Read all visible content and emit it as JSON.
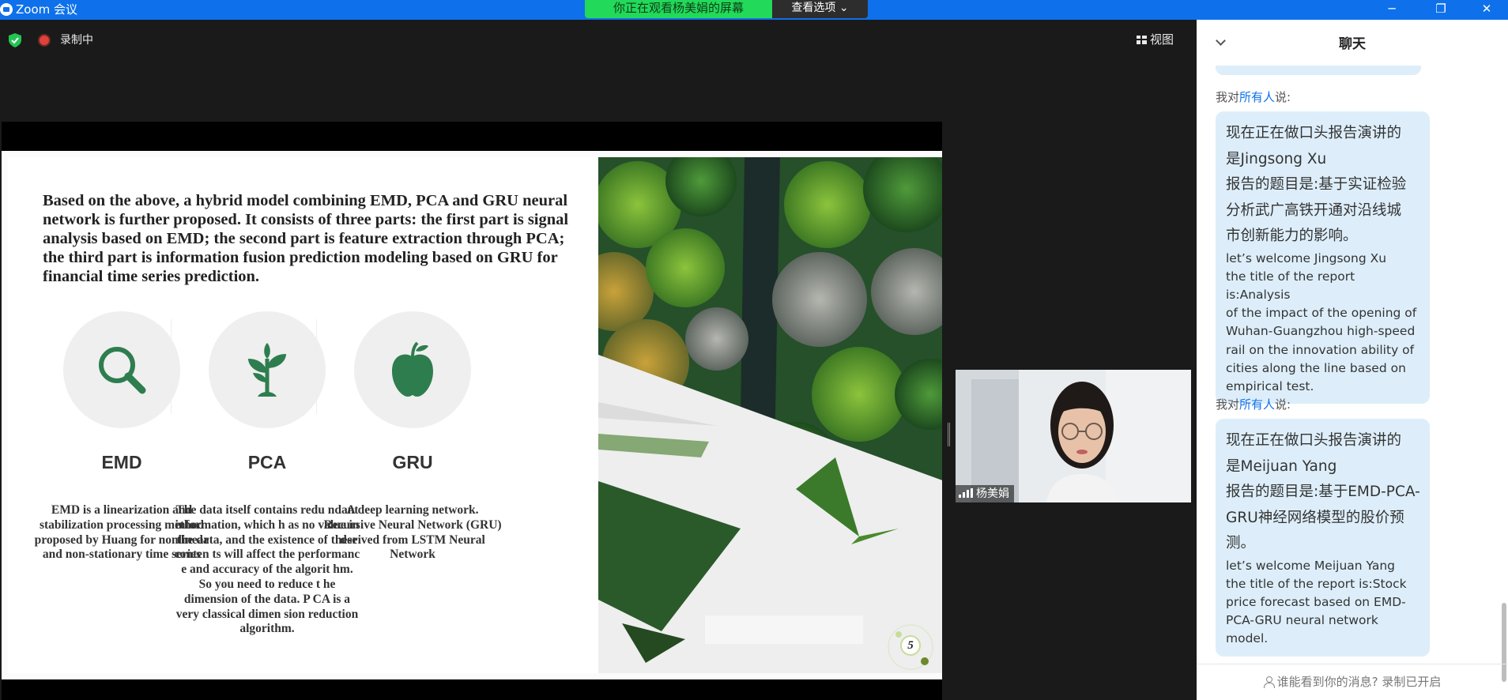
{
  "window": {
    "title": "Zoom 会议",
    "share_banner": "你正在观看杨美娟的屏幕",
    "view_options": "查看选项",
    "minimize": "─",
    "restore": "❐",
    "close": "✕"
  },
  "toolbar": {
    "recording": "录制中",
    "view": "视图"
  },
  "slide": {
    "paragraph": "Based on the above, a hybrid model combining EMD, PCA and GRU neural network is further proposed. It consists of three parts: the first part is signal analysis based on EMD; the second part is feature extraction through PCA; the third part is information fusion prediction modeling based on GRU for financial time series prediction.",
    "features": [
      {
        "name": "EMD",
        "desc": "EMD is a linearization and stabilization processing method proposed by Huang for nonlinear and non-stationary time series",
        "icon": "magnifier-icon"
      },
      {
        "name": "PCA",
        "desc": "The data itself contains redu ndant information, which h as no value in the data, and the existence of these conten ts will affect the performanc e and accuracy of the algorit hm. So you need to reduce t he dimension of the data. P CA is a very classical dimen sion reduction algorithm.",
        "icon": "sprout-icon"
      },
      {
        "name": "GRU",
        "desc": "A deep learning network. Recursive Neural Network (GRU) derived from LSTM Neural Network",
        "icon": "apple-icon"
      }
    ],
    "page_number": "5",
    "accent_color": "#2e7d4f"
  },
  "video": {
    "participant": "杨美娟"
  },
  "chat": {
    "title": "聊天",
    "messages": [
      {
        "prefix": "我对",
        "to": "所有人",
        "suffix": "说:",
        "zh": [
          "现在正在做口头报告演讲的",
          "是Jingsong Xu",
          "报告的题目是:基于实证检验",
          "分析武广高铁开通对沿线城",
          "市创新能力的影响。"
        ],
        "en": [
          "let’s welcome Jingsong Xu",
          "the title of the report is:Analysis",
          "of the impact of the opening of",
          "Wuhan-Guangzhou high-speed",
          "rail on the innovation ability of",
          "cities along the line based on",
          "empirical test."
        ]
      },
      {
        "prefix": "我对",
        "to": "所有人",
        "suffix": "说:",
        "zh": [
          "现在正在做口头报告演讲的",
          "是Meijuan Yang",
          "报告的题目是:基于EMD-PCA-",
          "GRU神经网络模型的股价预",
          "测。"
        ],
        "en": [
          "let’s welcome Meijuan Yang",
          "the title of the report is:Stock",
          "price forecast based on EMD-",
          "PCA-GRU neural network",
          "model."
        ]
      }
    ],
    "footer": "谁能看到你的消息? 录制已开启"
  }
}
